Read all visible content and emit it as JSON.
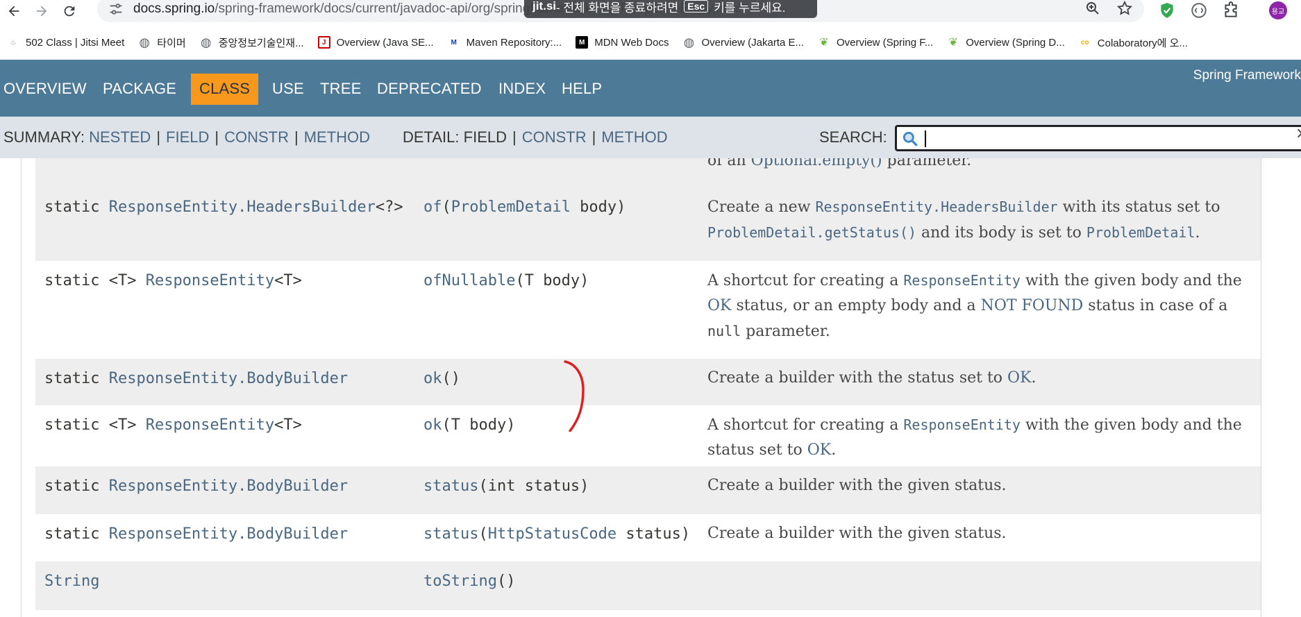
{
  "browser": {
    "url_main": "docs.spring.io",
    "url_path": "/spring-framework/docs/current/javadoc-api/org/springframework/http/ResponseEntity.html",
    "fullscreen_notice": {
      "app": "jit.si",
      "text_before": " - 전체 화면을 종료하려면",
      "key": "Esc",
      "text_after": "키를 누르세요."
    },
    "profile_label": "용교",
    "bookmarks": [
      {
        "label": "502 Class | Jitsi Meet",
        "icon": "jitsi-icon",
        "color": "#888888"
      },
      {
        "label": "타이머",
        "icon": "globe-icon",
        "color": "#5f6368"
      },
      {
        "label": "중앙정보기술인재...",
        "icon": "globe-icon",
        "color": "#5f6368"
      },
      {
        "label": "Overview (Java SE...",
        "icon": "java-icon",
        "color": "#c80000"
      },
      {
        "label": "Maven Repository:...",
        "icon": "maven-icon",
        "color": "#1b3fa0"
      },
      {
        "label": "MDN Web Docs",
        "icon": "mdn-icon",
        "color": "#000000"
      },
      {
        "label": "Overview (Jakarta E...",
        "icon": "globe-icon",
        "color": "#5f6368"
      },
      {
        "label": "Overview (Spring F...",
        "icon": "spring-icon",
        "color": "#6db33f"
      },
      {
        "label": "Overview (Spring D...",
        "icon": "spring-icon",
        "color": "#6db33f"
      },
      {
        "label": "Colaboratory에 오...",
        "icon": "colab-icon",
        "color": "#f9ab00"
      }
    ]
  },
  "doc": {
    "about": "Spring Framework",
    "nav": [
      "OVERVIEW",
      "PACKAGE",
      "CLASS",
      "USE",
      "TREE",
      "DEPRECATED",
      "INDEX",
      "HELP"
    ],
    "active_nav": "CLASS",
    "summary_label": "SUMMARY:",
    "summary_links": [
      "NESTED",
      "FIELD",
      "CONSTR",
      "METHOD"
    ],
    "detail_label": "DETAIL:",
    "detail_items": [
      {
        "text": "FIELD",
        "link": false
      },
      {
        "text": "CONSTR",
        "link": true
      },
      {
        "text": "METHOD",
        "link": true
      }
    ],
    "search_label": "SEARCH:",
    "search_value": "",
    "sep": "|",
    "partial_row": {
      "pre": "of an ",
      "link": "Optional.empty()",
      "post": " parameter."
    },
    "rows": [
      {
        "mod": "static ",
        "generic": "",
        "type_link": "ResponseEntity.HeadersBuilder",
        "type_suffix": "<?>",
        "method": "of",
        "params_pre": "(",
        "param_link": "ProblemDetail",
        "params_post": " body)",
        "desc": [
          {
            "t": "Create a new "
          },
          {
            "t": "ResponseEntity.HeadersBuilder",
            "code": true,
            "link": true
          },
          {
            "t": " with its status set to "
          },
          {
            "t": "ProblemDetail.getStatus()",
            "code": true,
            "link": true
          },
          {
            "t": " and its body is set to "
          },
          {
            "t": "ProblemDetail",
            "code": true,
            "link": true
          },
          {
            "t": "."
          }
        ]
      },
      {
        "mod": "static ",
        "generic": "<T> ",
        "type_link": "ResponseEntity",
        "type_suffix": "<T>",
        "method": "ofNullable",
        "params_pre": "(T body)",
        "param_link": "",
        "params_post": "",
        "desc": [
          {
            "t": "A shortcut for creating a "
          },
          {
            "t": "ResponseEntity",
            "code": true,
            "link": true
          },
          {
            "t": " with the given body and the "
          },
          {
            "t": "OK",
            "link": true
          },
          {
            "t": " status, or an empty body and a "
          },
          {
            "t": "NOT FOUND",
            "link": true
          },
          {
            "t": " status in case of a "
          },
          {
            "t": "null",
            "code": true
          },
          {
            "t": " parameter."
          }
        ]
      },
      {
        "mod": "static ",
        "generic": "",
        "type_link": "ResponseEntity.BodyBuilder",
        "type_suffix": "",
        "method": "ok",
        "params_pre": "()",
        "param_link": "",
        "params_post": "",
        "desc": [
          {
            "t": "Create a builder with the status set to "
          },
          {
            "t": "OK",
            "link": true
          },
          {
            "t": "."
          }
        ]
      },
      {
        "mod": "static ",
        "generic": "<T> ",
        "type_link": "ResponseEntity",
        "type_suffix": "<T>",
        "method": "ok",
        "params_pre": "(T body)",
        "param_link": "",
        "params_post": "",
        "desc": [
          {
            "t": "A shortcut for creating a "
          },
          {
            "t": "ResponseEntity",
            "code": true,
            "link": true
          },
          {
            "t": " with the given body and the status set to "
          },
          {
            "t": "OK",
            "link": true
          },
          {
            "t": "."
          }
        ]
      },
      {
        "mod": "static ",
        "generic": "",
        "type_link": "ResponseEntity.BodyBuilder",
        "type_suffix": "",
        "method": "status",
        "params_pre": "(int status)",
        "param_link": "",
        "params_post": "",
        "desc": [
          {
            "t": "Create a builder with the given status."
          }
        ]
      },
      {
        "mod": "static ",
        "generic": "",
        "type_link": "ResponseEntity.BodyBuilder",
        "type_suffix": "",
        "method": "status",
        "params_pre": "(",
        "param_link": "HttpStatusCode",
        "params_post": " status)",
        "desc": [
          {
            "t": "Create a builder with the given status."
          }
        ]
      },
      {
        "mod": "",
        "generic": "",
        "type_link": "String",
        "type_suffix": "",
        "method": "toString",
        "params_pre": "()",
        "param_link": "",
        "params_post": "",
        "desc": []
      }
    ]
  },
  "colors": {
    "nav_bg": "#4d7a97",
    "nav_active_bg": "#f8981d",
    "subnav_bg": "#dee3e9",
    "link": "#4a6782",
    "row_alt": "#eeeeef",
    "annotation": "#e02020"
  }
}
